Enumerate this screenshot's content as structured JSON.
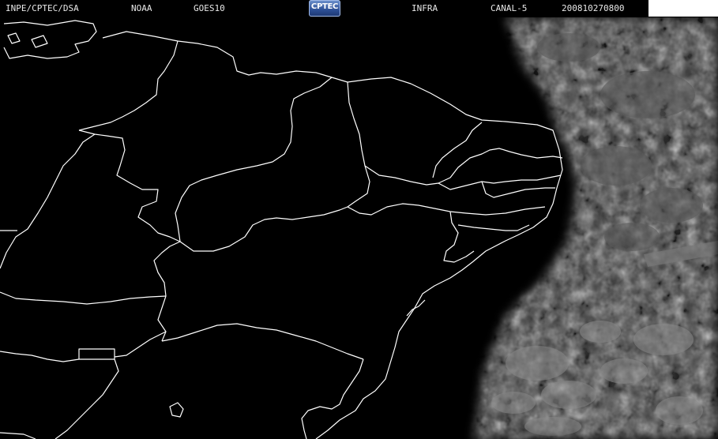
{
  "header": {
    "agency": "INPE/CPTEC/DSA",
    "noaa": "NOAA",
    "satellite": "GOES10",
    "logo": "CPTEC",
    "product": "INFRA",
    "channel": "CANAL-5",
    "timestamp": "200810270800"
  },
  "colors": {
    "background": "#000000",
    "borders": "#ffffff",
    "clouds": "#6e6e6e"
  }
}
